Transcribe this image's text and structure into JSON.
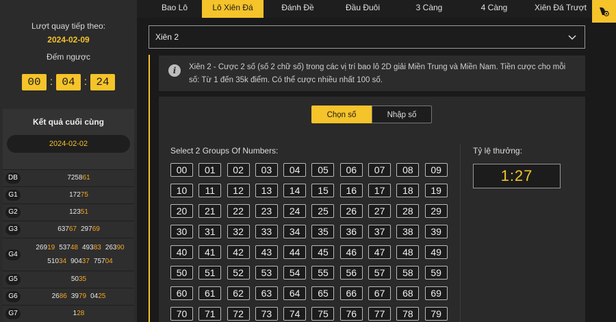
{
  "sidebar": {
    "next_draw_label": "Lượt quay tiếp theo:",
    "next_draw_date": "2024-02-09",
    "countdown_label": "Đếm ngược",
    "countdown": {
      "hours": "00",
      "minutes": "04",
      "seconds": "24"
    },
    "results_title": "Kết quả cuối cùng",
    "results_date": "2024-02-02",
    "results": [
      {
        "label": "DB",
        "numbers": [
          {
            "pre": "7258",
            "hl": "61"
          }
        ]
      },
      {
        "label": "G1",
        "numbers": [
          {
            "pre": "172",
            "hl": "75"
          }
        ]
      },
      {
        "label": "G2",
        "numbers": [
          {
            "pre": "123",
            "hl": "51"
          }
        ]
      },
      {
        "label": "G3",
        "numbers": [
          {
            "pre": "637",
            "hl": "67"
          },
          {
            "pre": "297",
            "hl": "69"
          }
        ]
      },
      {
        "label": "G4",
        "numbers": [
          {
            "pre": "269",
            "hl": "19"
          },
          {
            "pre": "537",
            "hl": "48"
          },
          {
            "pre": "493",
            "hl": "83"
          },
          {
            "pre": "263",
            "hl": "90"
          },
          {
            "pre": "510",
            "hl": "34"
          },
          {
            "pre": "904",
            "hl": "37"
          },
          {
            "pre": "757",
            "hl": "04"
          }
        ]
      },
      {
        "label": "G5",
        "numbers": [
          {
            "pre": "50",
            "hl": "35"
          }
        ]
      },
      {
        "label": "G6",
        "numbers": [
          {
            "pre": "26",
            "hl": "86"
          },
          {
            "pre": "39",
            "hl": "79"
          },
          {
            "pre": "04",
            "hl": "25"
          }
        ]
      },
      {
        "label": "G7",
        "numbers": [
          {
            "pre": "1",
            "hl": "28"
          }
        ]
      }
    ]
  },
  "tabs": [
    "Bao Lô",
    "Lô Xiên Đá",
    "Đánh Đề",
    "Đầu Đuôi",
    "3 Càng",
    "4 Càng",
    "Xiên Đá Trượt"
  ],
  "active_tab": 1,
  "select": {
    "value": "Xiên 2"
  },
  "info": {
    "text": "Xiên 2 - Cược 2 số (số 2 chữ số) trong các vị trí bao lô 2D giải Miền Trung và Miền Nam. Tiền cược cho mỗi số: Từ 1 đến 35k điểm. Có thể cược nhiều nhất 100 số."
  },
  "mode": {
    "pick_label": "Chọn số",
    "input_label": "Nhập số"
  },
  "grid": {
    "title": "Select 2 Groups Of Numbers:",
    "numbers": [
      "00",
      "01",
      "02",
      "03",
      "04",
      "05",
      "06",
      "07",
      "08",
      "09",
      "10",
      "11",
      "12",
      "13",
      "14",
      "15",
      "16",
      "17",
      "18",
      "19",
      "20",
      "21",
      "22",
      "23",
      "24",
      "25",
      "26",
      "27",
      "28",
      "29",
      "30",
      "31",
      "32",
      "33",
      "34",
      "35",
      "36",
      "37",
      "38",
      "39",
      "40",
      "41",
      "42",
      "43",
      "44",
      "45",
      "46",
      "47",
      "48",
      "49",
      "50",
      "51",
      "52",
      "53",
      "54",
      "55",
      "56",
      "57",
      "58",
      "59",
      "60",
      "61",
      "62",
      "63",
      "64",
      "65",
      "66",
      "67",
      "68",
      "69",
      "70",
      "71",
      "72",
      "73",
      "74",
      "75",
      "76",
      "77",
      "78",
      "79"
    ]
  },
  "rate": {
    "label": "Tỷ lệ thưởng:",
    "value": "1:27"
  },
  "colors": {
    "accent": "#f5c32a",
    "highlight": "#f5a623",
    "background": "#1a1a1a"
  }
}
